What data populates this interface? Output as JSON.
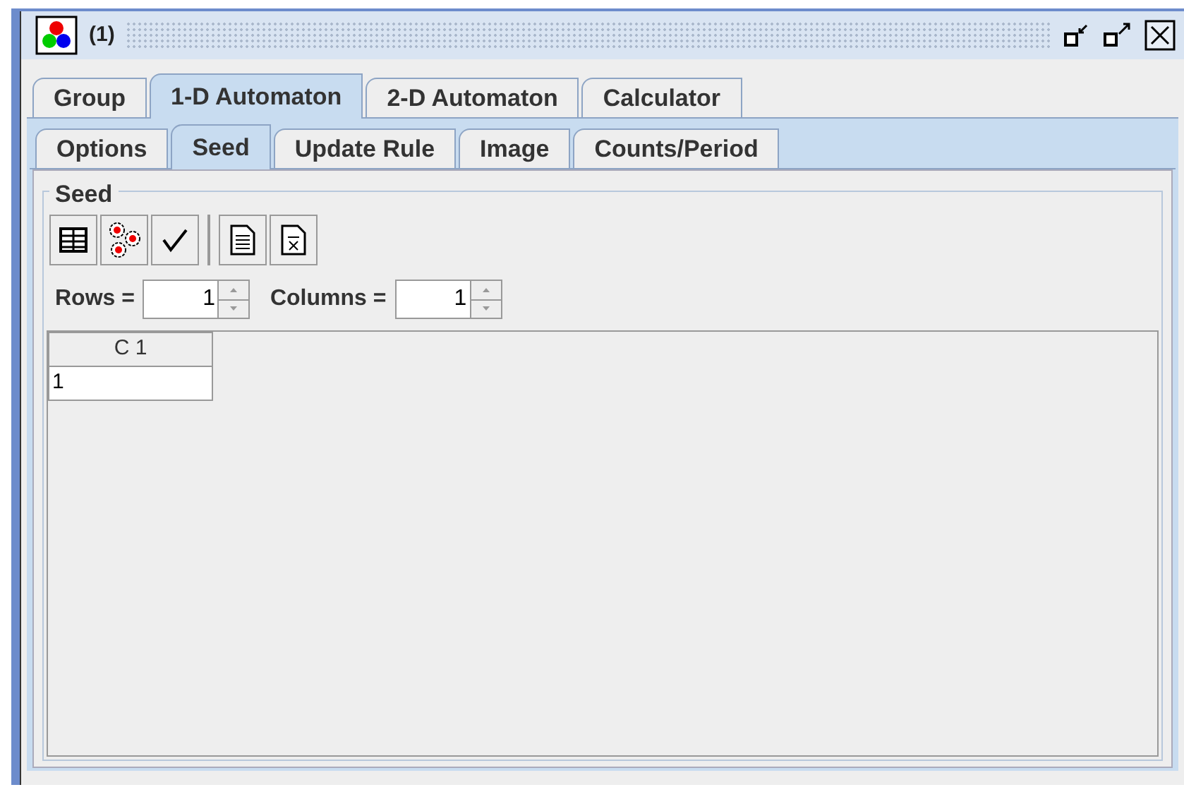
{
  "window": {
    "title": "(1)"
  },
  "main_tabs": [
    {
      "label": "Group",
      "selected": false
    },
    {
      "label": "1-D Automaton",
      "selected": true
    },
    {
      "label": "2-D Automaton",
      "selected": false
    },
    {
      "label": "Calculator",
      "selected": false
    }
  ],
  "sub_tabs": [
    {
      "label": "Options",
      "selected": false
    },
    {
      "label": "Seed",
      "selected": true
    },
    {
      "label": "Update Rule",
      "selected": false
    },
    {
      "label": "Image",
      "selected": false
    },
    {
      "label": "Counts/Period",
      "selected": false
    }
  ],
  "seed": {
    "title": "Seed",
    "rows": {
      "label": "Rows =",
      "value": "1"
    },
    "columns": {
      "label": "Columns =",
      "value": "1"
    },
    "table": {
      "columns": [
        "C 1"
      ],
      "rows": [
        [
          "1"
        ]
      ]
    }
  }
}
